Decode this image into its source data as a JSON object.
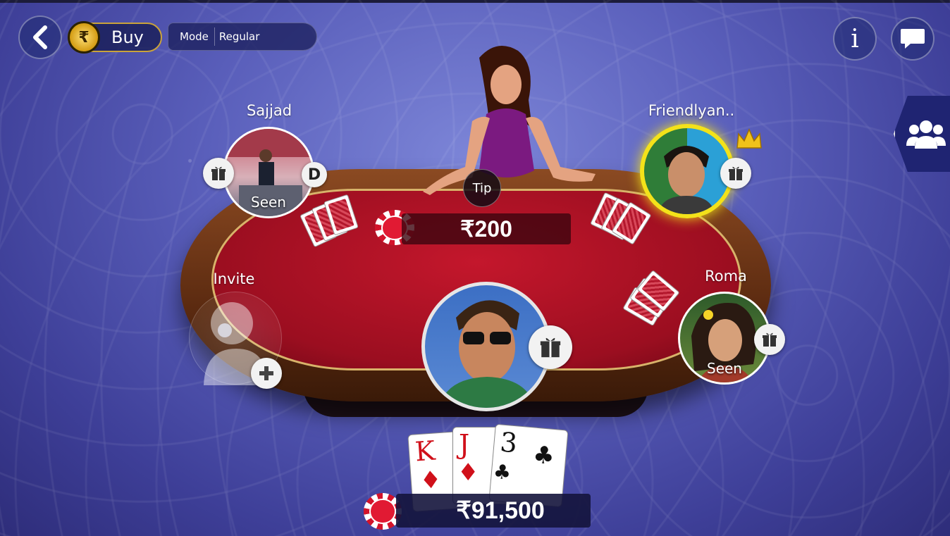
{
  "topbar": {
    "buy_label": "Buy",
    "coin_symbol": "₹",
    "mode_key": "Mode",
    "mode_value": "Regular",
    "info_symbol": "i"
  },
  "dealer": {
    "tip_label": "Tip"
  },
  "table": {
    "pot": "₹200",
    "dealer_marker": "D"
  },
  "players": {
    "top_left": {
      "name": "Sajjad",
      "status": "Seen"
    },
    "top_right": {
      "name": "Friendlyan.."
    },
    "right": {
      "name": "Roma",
      "status": "Seen"
    },
    "left": {
      "name": "Invite"
    }
  },
  "hand": {
    "cards": [
      {
        "rank": "K",
        "suit": "♦",
        "color": "#d0101a"
      },
      {
        "rank": "J",
        "suit": "♦",
        "color": "#d0101a"
      },
      {
        "rank": "3",
        "suit": "♣",
        "color": "#111111"
      }
    ]
  },
  "balance": "₹91,500",
  "colors": {
    "chip_red": "#e11a33",
    "crown": "#f1c21b",
    "highlight_ring": "#f3e21a"
  }
}
